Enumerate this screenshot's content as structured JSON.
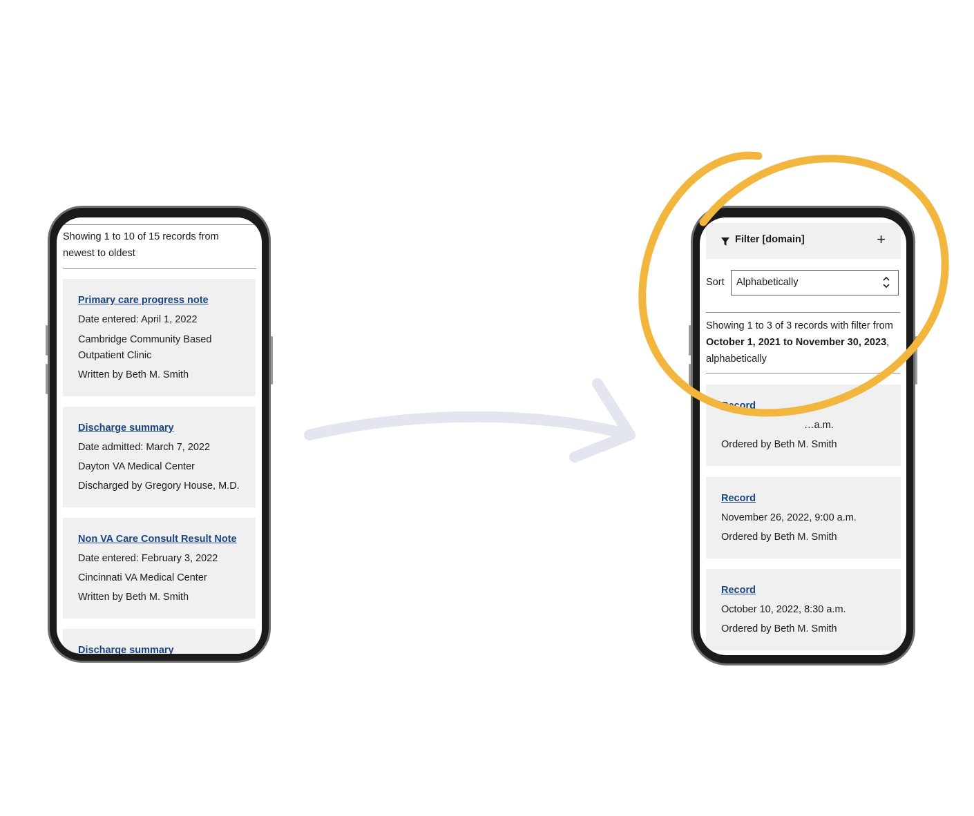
{
  "left_phone": {
    "summary": "Showing 1 to 10 of 15 records from newest to oldest",
    "cards": [
      {
        "title": "Primary care progress note",
        "lines": [
          "Date entered: April 1, 2022",
          "Cambridge Community Based Outpatient Clinic",
          "Written by Beth M. Smith"
        ]
      },
      {
        "title": "Discharge summary",
        "lines": [
          "Date admitted: March 7, 2022",
          "Dayton VA Medical Center",
          "Discharged by Gregory House, M.D."
        ]
      },
      {
        "title": "Non VA Care Consult Result Note",
        "lines": [
          "Date entered: February 3, 2022",
          "Cincinnati VA Medical Center",
          "Written by Beth M. Smith"
        ]
      },
      {
        "title": "Discharge summary",
        "lines": []
      }
    ]
  },
  "right_phone": {
    "filter": {
      "label": "Filter [domain]",
      "icon": "funnel-icon",
      "toggle_icon": "plus-icon",
      "toggle": "+"
    },
    "sort": {
      "label": "Sort",
      "value": "Alphabetically",
      "icon": "select-updown-icon"
    },
    "summary": {
      "prefix": "Showing 1 to 3 of 3 records with filter from ",
      "range": "October 1, 2021 to November 30, 2023",
      "suffix": ", alphabetically"
    },
    "cards": [
      {
        "title": "Record",
        "lines": [
          "…a.m.",
          "Ordered by Beth M. Smith"
        ]
      },
      {
        "title": "Record",
        "lines": [
          "November 26, 2022, 9:00 a.m.",
          "Ordered by Beth M. Smith"
        ]
      },
      {
        "title": "Record",
        "lines": [
          "October 10, 2022, 8:30 a.m.",
          "Ordered by Beth M. Smith"
        ]
      }
    ]
  },
  "colors": {
    "link": "#1a4480",
    "card_bg": "#f0f0f0",
    "highlight": "#f2b53e",
    "arrow": "#e3e6ee"
  }
}
